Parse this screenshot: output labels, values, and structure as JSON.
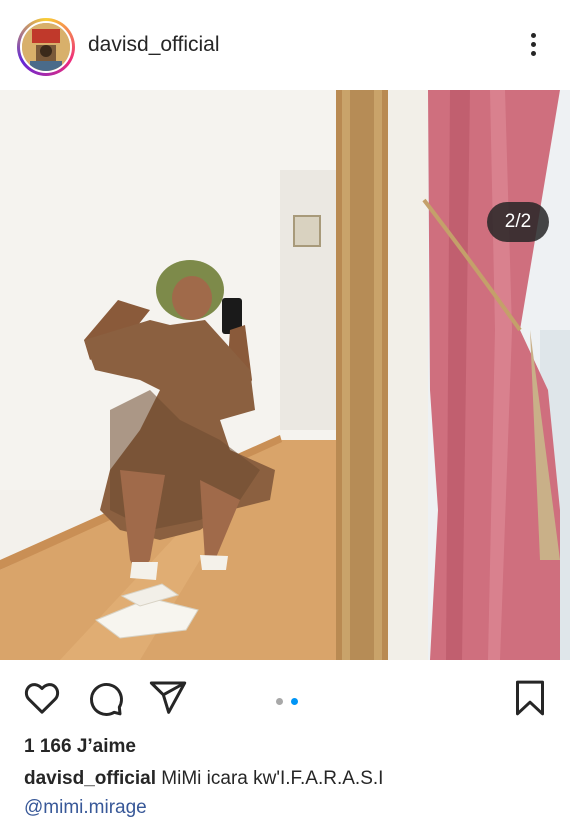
{
  "post": {
    "username": "davisd_official",
    "carousel_counter": "2/2",
    "carousel_total": 2,
    "carousel_active_index": 2,
    "likes": "1 166 J’aime",
    "caption_username": "davisd_official",
    "caption_text": "MiMi icara kw'I.F.A.R.A.S.I",
    "mention": "@mimi.mirage"
  },
  "colors": {
    "text": "#262626",
    "active_dot": "#0095f6",
    "inactive_dot": "#a8a8a8",
    "mention": "#385898"
  },
  "icons": {
    "like": "heart-icon",
    "comment": "comment-icon",
    "share": "share-icon",
    "save": "bookmark-icon",
    "more": "more-options-icon"
  }
}
